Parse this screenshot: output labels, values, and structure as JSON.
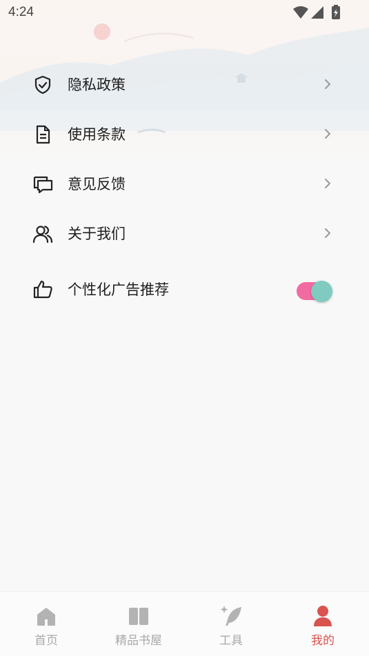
{
  "status_bar": {
    "time": "4:24"
  },
  "menu": {
    "items": [
      {
        "label": "隐私政策",
        "icon": "shield-check-icon"
      },
      {
        "label": "使用条款",
        "icon": "document-icon"
      },
      {
        "label": "意见反馈",
        "icon": "chat-bubbles-icon"
      },
      {
        "label": "关于我们",
        "icon": "users-icon"
      }
    ],
    "ad_toggle": {
      "label": "个性化广告推荐",
      "icon": "thumbs-up-icon",
      "enabled": true
    }
  },
  "tabbar": {
    "tabs": [
      {
        "label": "首页",
        "icon": "home-icon",
        "active": false
      },
      {
        "label": "精品书屋",
        "icon": "book-icon",
        "active": false
      },
      {
        "label": "工具",
        "icon": "quill-sparkle-icon",
        "active": false
      },
      {
        "label": "我的",
        "icon": "person-icon",
        "active": true
      }
    ]
  },
  "colors": {
    "accent": "#d9534f",
    "toggle_track": "#f26ba0",
    "toggle_knob": "#7fcbc0",
    "inactive_tab": "#a9a9a9"
  }
}
